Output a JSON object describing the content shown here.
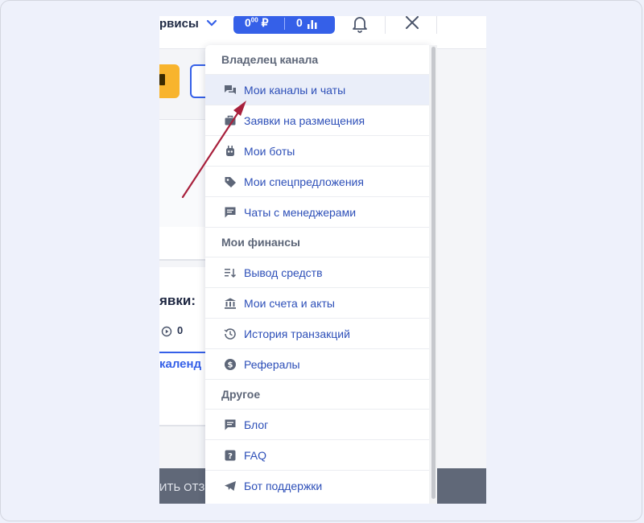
{
  "topbar": {
    "services_label": "рвисы",
    "balance_money": "0",
    "balance_money_cents": "00",
    "balance_currency": "₽",
    "balance_count": "0",
    "chevron_icon": "chevron-down-icon",
    "bell_icon": "bell-icon",
    "close_icon": "close-icon"
  },
  "background": {
    "section_title": "явки:",
    "counter_value": "0",
    "tab_label": "календ",
    "bottom_text": "ИТЬ ОТЗЫ"
  },
  "menu": {
    "sections": [
      {
        "title": "Владелец канала",
        "items": [
          {
            "label": "Мои каналы и чаты",
            "icon": "chats-icon",
            "active": true
          },
          {
            "label": "Заявки на размещения",
            "icon": "briefcase-icon"
          },
          {
            "label": "Мои боты",
            "icon": "bot-icon"
          },
          {
            "label": "Мои спецпредложения",
            "icon": "tag-icon"
          },
          {
            "label": "Чаты с менеджерами",
            "icon": "message-icon"
          }
        ]
      },
      {
        "title": "Мои финансы",
        "items": [
          {
            "label": "Вывод средств",
            "icon": "withdraw-icon"
          },
          {
            "label": "Мои счета и акты",
            "icon": "bank-icon"
          },
          {
            "label": "История транзакций",
            "icon": "history-icon"
          },
          {
            "label": "Рефералы",
            "icon": "dollar-icon"
          }
        ]
      },
      {
        "title": "Другое",
        "items": [
          {
            "label": "Блог",
            "icon": "blog-icon"
          },
          {
            "label": "FAQ",
            "icon": "help-icon"
          },
          {
            "label": "Бот поддержки",
            "icon": "telegram-icon"
          }
        ]
      }
    ]
  },
  "colors": {
    "accent": "#3560e8",
    "link": "#2d4fb8",
    "arrow": "#a8203c",
    "orange": "#f8b42d"
  }
}
